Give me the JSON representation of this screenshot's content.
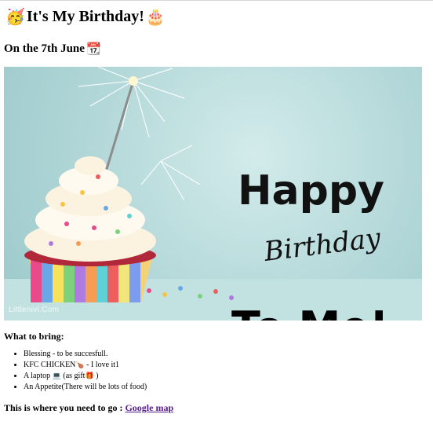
{
  "header": {
    "party_emoji": "🥳",
    "title": "It's My Birthday!",
    "cake_emoji": "🎂"
  },
  "subheader": {
    "date_text": "On the 7th June",
    "calendar_emoji": "📆"
  },
  "hero_image": {
    "line1": "Happy",
    "line2": "Birthday",
    "line3": "To Me!",
    "watermark": "Littlenivi.Com"
  },
  "bring": {
    "title": "What to bring:",
    "items": [
      {
        "text": "Blessing - to be succesfull."
      },
      {
        "text_before": "KFC CHICKEN",
        "emoji": "🍗",
        "text_after": " - I love it1"
      },
      {
        "text_before": "A laptop ",
        "emoji": "💻",
        "text_mid": " (as gift",
        "emoji2": "🎁",
        "text_after": " )"
      },
      {
        "text": "An Appetite(There will be lots of food)"
      }
    ]
  },
  "directions": {
    "text": "This is where you need to go : ",
    "link_label": "Google map"
  },
  "colors": {
    "link": "#551a8b",
    "hero_bg": "#b2d7d8"
  }
}
